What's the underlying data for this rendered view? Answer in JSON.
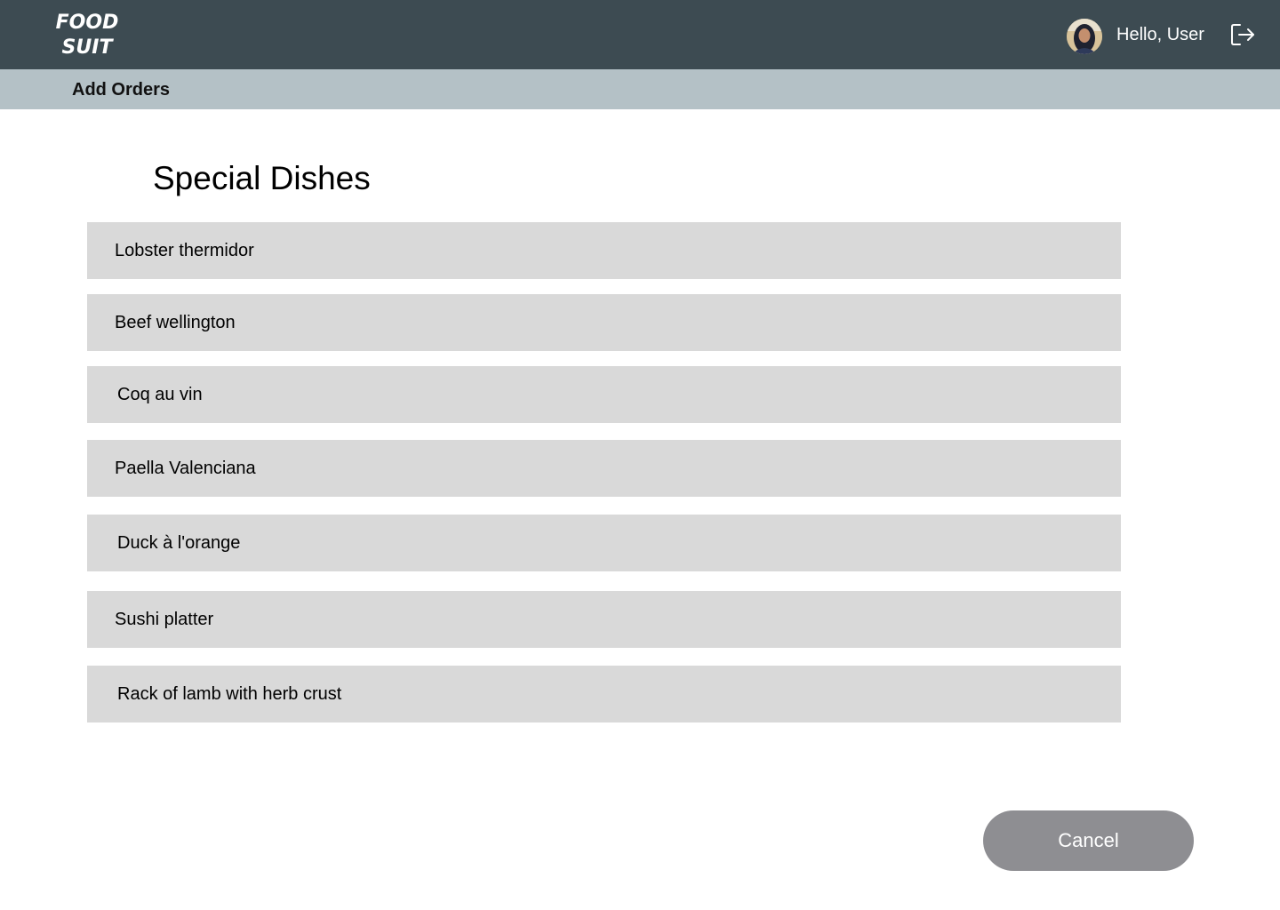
{
  "header": {
    "logo_line1": "FOOD",
    "logo_line2": "SUIT",
    "greeting": "Hello, User",
    "avatar_icon": "user-avatar",
    "logout_icon": "logout-icon",
    "bg_color": "#3d4b52"
  },
  "subheader": {
    "title": "Add Orders",
    "bg_color": "#b4c1c6"
  },
  "main": {
    "heading": "Special Dishes",
    "dishes": [
      "Lobster thermidor",
      "Beef wellington",
      "Coq au vin",
      "Paella Valenciana",
      "Duck à l'orange",
      "Sushi platter",
      "Rack of lamb with herb crust"
    ],
    "item_bg_color": "#d9d9d9"
  },
  "footer": {
    "cancel_label": "Cancel",
    "cancel_color": "#8e8e92"
  }
}
